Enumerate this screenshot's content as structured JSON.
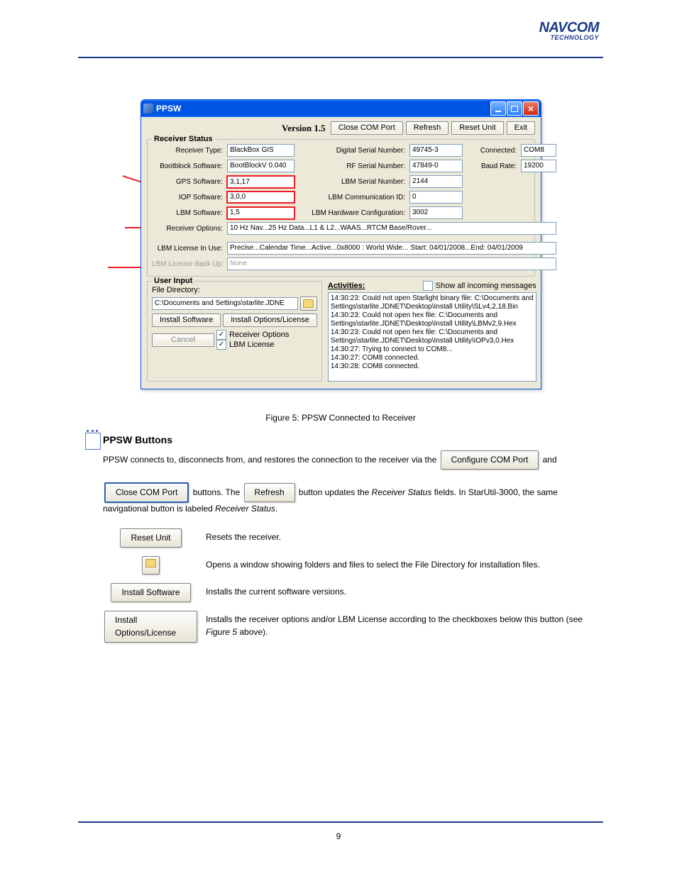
{
  "logo": {
    "main": "NAVCOM",
    "sub": "TECHNOLOGY"
  },
  "window": {
    "title": "PPSW",
    "version": "Version 1.5",
    "top_buttons": {
      "close_com": "Close COM Port",
      "refresh": "Refresh",
      "reset": "Reset Unit",
      "exit": "Exit"
    },
    "receiver_status_legend": "Receiver Status",
    "fields": {
      "receiver_type_lbl": "Receiver Type:",
      "receiver_type_val": "BlackBox GIS",
      "bootblock_lbl": "Bootblock Software:",
      "bootblock_val": "BootBlockV 0.040",
      "gps_lbl": "GPS Software:",
      "gps_val": "3,1,17",
      "iop_lbl": "IOP Software:",
      "iop_val": "3,0,0",
      "lbm_lbl": "LBM Software:",
      "lbm_val": "1,5",
      "dsn_lbl": "Digital Serial Number:",
      "dsn_val": "49745-3",
      "rfsn_lbl": "RF Serial Number:",
      "rfsn_val": "47849-0",
      "lbmsn_lbl": "LBM Serial Number:",
      "lbmsn_val": "2144",
      "lbmcid_lbl": "LBM Communication ID:",
      "lbmcid_val": "0",
      "lbmhw_lbl": "LBM Hardware Configuration:",
      "lbmhw_val": "3002",
      "connected_lbl": "Connected:",
      "connected_val": "COM8",
      "baud_lbl": "Baud Rate:",
      "baud_val": "19200",
      "recv_opt_lbl": "Receiver Options:",
      "recv_opt_val": "10 Hz Nav...25 Hz Data...L1 & L2...WAAS...RTCM Base/Rover...",
      "lic_inuse_lbl": "LBM License In Use:",
      "lic_inuse_val": "Precise...Calendar Time...Active...0x8000 : World Wide...     Start: 04/01/2008...End: 04/01/2009",
      "lic_backup_lbl": "LBM License Back Up:",
      "lic_backup_val": "None"
    },
    "user_input": {
      "legend": "User Input",
      "file_dir_lbl": "File Directory:",
      "file_dir_val": "C:\\Documents and Settings\\starlite.JDNE",
      "install_sw": "Install Software",
      "install_lic": "Install Options/License",
      "cancel": "Cancel",
      "cb_recv_opts": "Receiver Options",
      "cb_lbm_lic": "LBM License"
    },
    "activities": {
      "title": "Activities:",
      "show_all": "Show all incoming messages",
      "log": [
        "14:30:23: Could not open Starlight binary file: C:\\Documents and",
        "Settings\\starlite.JDNET\\Desktop\\Install Utility\\SLv4,2,18.Bin",
        "14:30:23: Could not open hex file: C:\\Documents and",
        "Settings\\starlite.JDNET\\Desktop\\Install Utility\\LBMv2,9.Hex",
        "14:30:23: Could not open hex file: C:\\Documents and",
        "Settings\\starlite.JDNET\\Desktop\\Install Utility\\IOPv3,0.Hex",
        "14:30:27: Trying to connect to COM8...",
        "14:30:27: COM8 connected.",
        "14:30:28: COM8 connected."
      ]
    }
  },
  "figure_caption": "Figure 5:  PPSW Connected to Receiver",
  "buttons_heading": "PPSW Buttons",
  "note_text_1": "PPSW connects to, disconnects from, and restores the connection to the receiver via the ",
  "note_text_2": " and ",
  "note_text_3": " buttons. The ",
  "note_text_4": " button updates the ",
  "note_text_5": "Receiver Status",
  "note_text_6": " fields. In StarUtil-3000, the same navigational button is labeled ",
  "note_text_7": "Receiver Status",
  "note_text_8": ".",
  "row1_btn": "Reset Unit",
  "row1_txt": "Resets the receiver.",
  "row2_txt": "Opens a window showing folders and files to select the File Directory for installation files.",
  "row3_btn": "Install Software",
  "row3_txt": "Installs the current software versions.",
  "row4_btn": "Install Options/License",
  "row4_txt1": "Installs the receiver options and/or LBM License according to the checkboxes below this button (see ",
  "row4_txt2": "Figure 5",
  "row4_txt3": " above).",
  "inline_buttons": {
    "configure": "Configure COM Port",
    "close": "Close COM Port",
    "refresh": "Refresh"
  },
  "page_number": "9"
}
